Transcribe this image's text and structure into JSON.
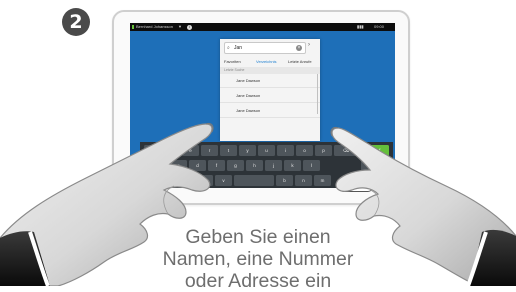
{
  "step_number": "2",
  "status_bar": {
    "user_name": "Bernhard Johansson",
    "chevron": "▼",
    "info": "i",
    "logo": "▮▮▮",
    "time": "09:00"
  },
  "search": {
    "query": "Jan",
    "search_icon": "search-icon",
    "clear_icon": "×",
    "next_icon": "›"
  },
  "tabs": [
    {
      "label": "Favoriten"
    },
    {
      "label": "Verzeichnis",
      "active": true
    },
    {
      "label": "Letzte Anrufe"
    }
  ],
  "section_header": "Letzte Suche",
  "results": [
    {
      "label": "Jane Dawson"
    },
    {
      "label": "Jane Dawson"
    },
    {
      "label": "Jane Dawson"
    }
  ],
  "keyboard": {
    "row1": [
      "q",
      "w",
      "e",
      "r",
      "t",
      "y",
      "u",
      "i",
      "o",
      "p"
    ],
    "row2": [
      "a",
      "s",
      "d",
      "f",
      "g",
      "h",
      "j",
      "k",
      "l"
    ],
    "row3": [
      "z",
      "x",
      "c",
      "v",
      "b",
      "n",
      "m"
    ],
    "backspace": "⌫",
    "enter": "Anruf",
    "space": "",
    "hide": "≡"
  },
  "caption": {
    "line1": "Geben Sie einen",
    "line2": "Namen, eine Nummer",
    "line3": "oder Adresse ein"
  },
  "colors": {
    "screen_blue": "#1e6fb8",
    "enter_green": "#64bf3b",
    "active_tab": "#1e7fd0",
    "badge": "#4a4a4a"
  }
}
